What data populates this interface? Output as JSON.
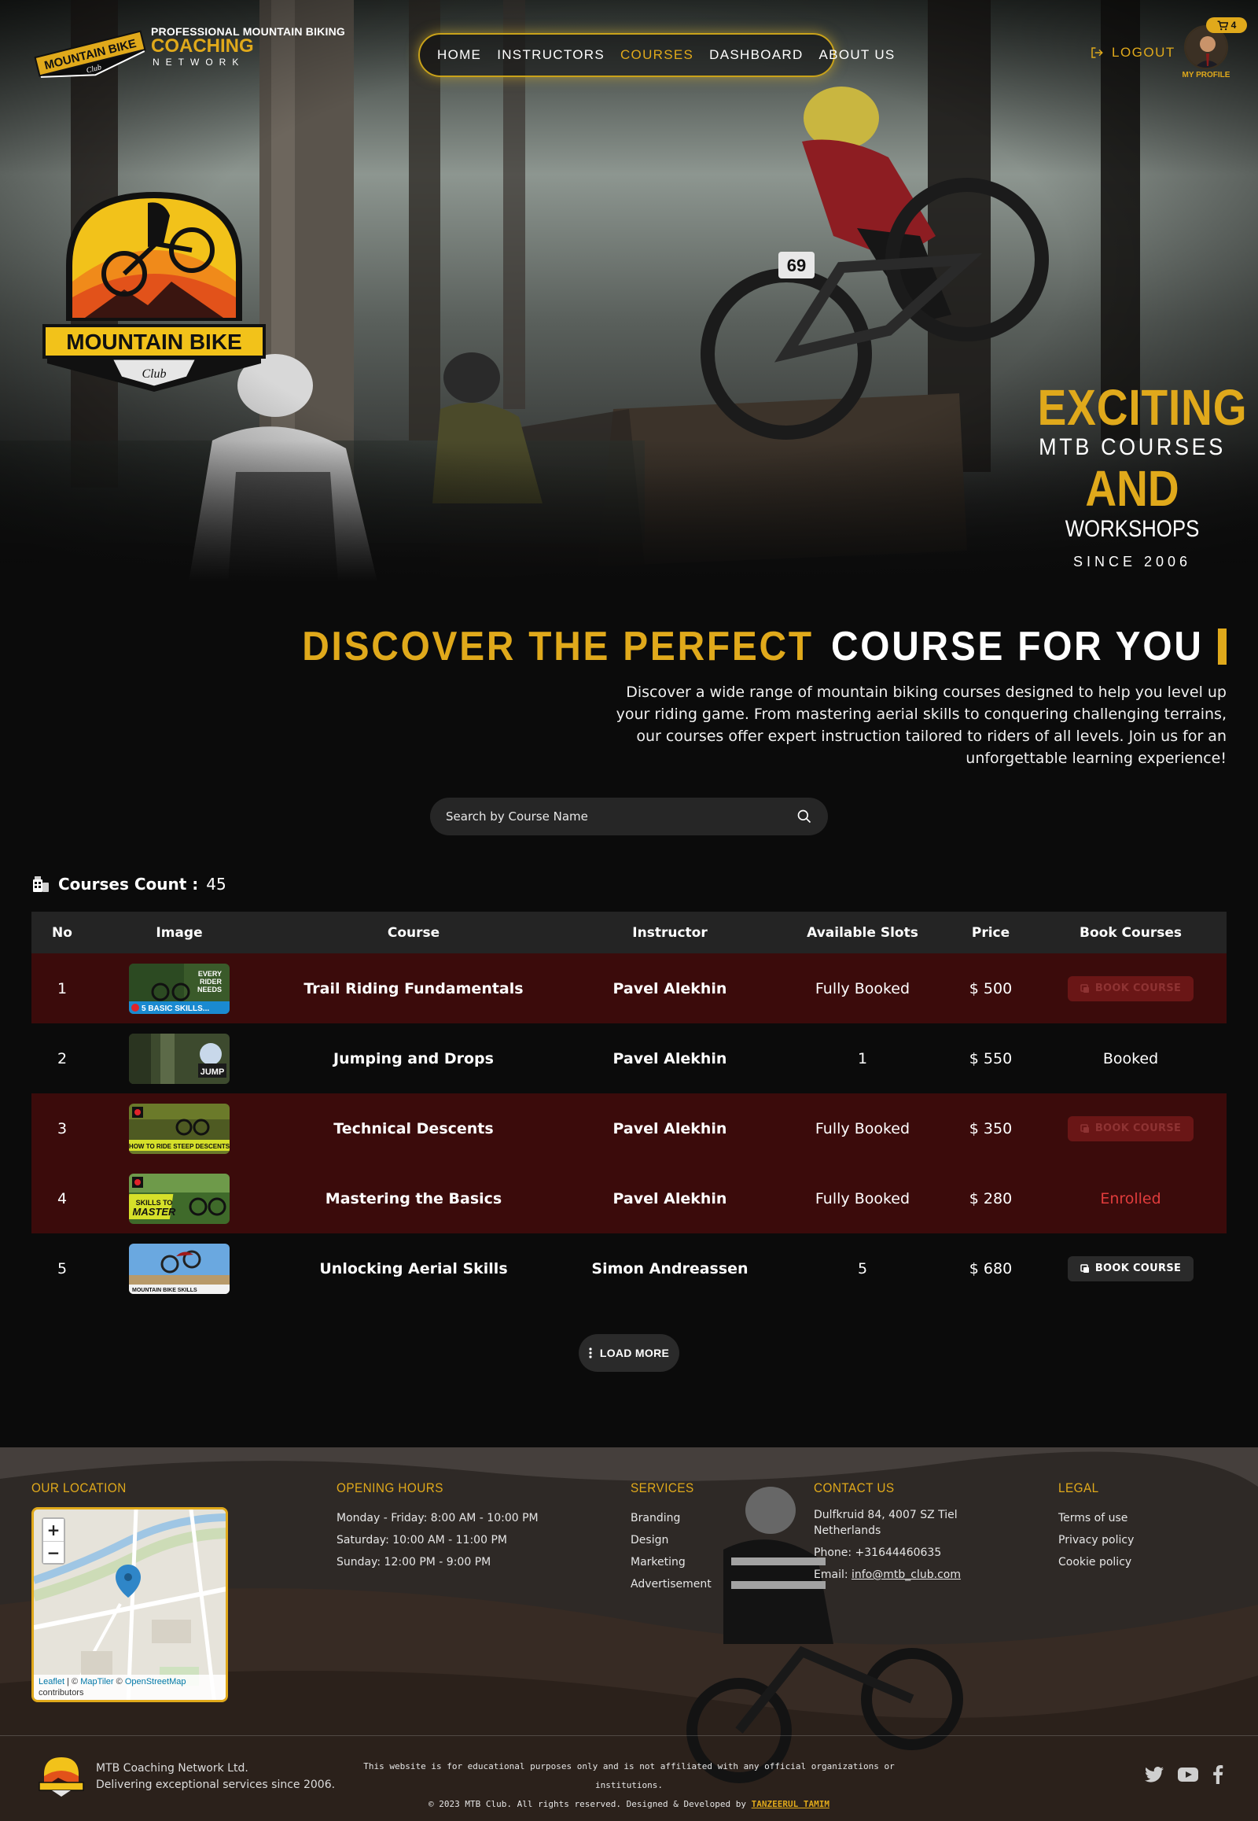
{
  "header": {
    "brand": {
      "badge_text": "MOUNTAIN BIKE",
      "badge_sub": "Club",
      "line1": "PROFESSIONAL MOUNTAIN BIKING",
      "line2": "COACHING",
      "line3": "NETWORK"
    },
    "nav": [
      {
        "label": "HOME",
        "active": false
      },
      {
        "label": "INSTRUCTORS",
        "active": false
      },
      {
        "label": "COURSES",
        "active": true
      },
      {
        "label": "DASHBOARD",
        "active": false
      },
      {
        "label": "ABOUT US",
        "active": false
      }
    ],
    "logout_label": "LOGOUT",
    "cart_count": "4",
    "profile_label": "MY PROFILE"
  },
  "hero": {
    "logo_text": "MOUNTAIN BIKE",
    "logo_sub": "Club",
    "bike_number": "69",
    "tagline": {
      "line1": "EXCITING",
      "line2": "MTB COURSES",
      "line3": "AND",
      "line4": "WORKSHOPS",
      "line5": "SINCE 2006"
    }
  },
  "discover": {
    "title_gold": "DISCOVER THE PERFECT",
    "title_white": "COURSE FOR YOU",
    "text": "Discover a wide range of mountain biking courses designed to help you level up your riding game. From mastering aerial skills to conquering challenging terrains, our courses offer expert instruction tailored to riders of all levels. Join us for an unforgettable learning experience!"
  },
  "search": {
    "placeholder": "Search by Course Name",
    "icon": "search-icon"
  },
  "courses_count": {
    "label": "Courses Count :",
    "value": "45"
  },
  "table": {
    "headers": [
      "No",
      "Image",
      "Course",
      "Instructor",
      "Available Slots",
      "Price",
      "Book Courses"
    ],
    "rows": [
      {
        "no": "1",
        "course": "Trail Riding Fundamentals",
        "instructor": "Pavel Alekhin",
        "slots": "Fully Booked",
        "price": "$ 500",
        "action": "BOOK COURSE",
        "action_type": "disabled",
        "thumb_text": "EVERY RIDER NEEDS",
        "thumb_sub": "5 BASIC SKILLS...",
        "theme": "red"
      },
      {
        "no": "2",
        "course": "Jumping and Drops",
        "instructor": "Pavel Alekhin",
        "slots": "1",
        "price": "$ 550",
        "action": "Booked",
        "action_type": "booked",
        "thumb_text": "JUMP",
        "thumb_sub": "",
        "theme": "dark"
      },
      {
        "no": "3",
        "course": "Technical Descents",
        "instructor": "Pavel Alekhin",
        "slots": "Fully Booked",
        "price": "$ 350",
        "action": "BOOK COURSE",
        "action_type": "disabled",
        "thumb_text": "HOW TO RIDE STEEP DESCENTS",
        "thumb_sub": "",
        "theme": "red"
      },
      {
        "no": "4",
        "course": "Mastering the Basics",
        "instructor": "Pavel Alekhin",
        "slots": "Fully Booked",
        "price": "$ 280",
        "action": "Enrolled",
        "action_type": "enrolled",
        "thumb_text": "SKILLS TO MASTER",
        "thumb_sub": "",
        "theme": "red"
      },
      {
        "no": "5",
        "course": "Unlocking Aerial Skills",
        "instructor": "Simon Andreassen",
        "slots": "5",
        "price": "$ 680",
        "action": "BOOK COURSE",
        "action_type": "enabled",
        "thumb_text": "MOUNTAIN BIKE SKILLS",
        "thumb_sub": "",
        "theme": "dark"
      }
    ]
  },
  "load_more_label": "LOAD MORE",
  "footer": {
    "location": {
      "heading": "OUR LOCATION",
      "zoom_in": "+",
      "zoom_out": "−",
      "attribution_leaflet": "Leaflet",
      "attribution_sep1": "| ©",
      "attribution_maptiler": "MapTiler",
      "attribution_sep2": "©",
      "attribution_osm": "OpenStreetMap",
      "attribution_end": "contributors"
    },
    "hours": {
      "heading": "OPENING HOURS",
      "items": [
        "Monday - Friday: 8:00 AM - 10:00 PM",
        "Saturday: 10:00 AM - 11:00 PM",
        "Sunday: 12:00 PM - 9:00 PM"
      ]
    },
    "services": {
      "heading": "SERVICES",
      "items": [
        "Branding",
        "Design",
        "Marketing",
        "Advertisement"
      ]
    },
    "contact": {
      "heading": "CONTACT US",
      "address": "Dulfkruid 84, 4007 SZ Tiel Netherlands",
      "phone": "Phone: +31644460635",
      "email_label": "Email:",
      "email": "info@mtb_club.com"
    },
    "legal": {
      "heading": "LEGAL",
      "items": [
        "Terms of use",
        "Privacy policy",
        "Cookie policy"
      ]
    },
    "company_name": "MTB Coaching Network Ltd.",
    "company_tagline": "Delivering exceptional services since 2006.",
    "disclaimer": "This website is for educational purposes only and is not affiliated with any official organizations or institutions.",
    "copyright": "© 2023 MTB Club. All rights reserved. Designed & Developed by",
    "developer": "TANZEERUL TAMIM",
    "socials": [
      "twitter-icon",
      "youtube-icon",
      "facebook-icon"
    ]
  },
  "colors": {
    "accent": "#e0a91b",
    "row_highlight": "#3b0b0b",
    "enrolled": "#e13c3c"
  }
}
